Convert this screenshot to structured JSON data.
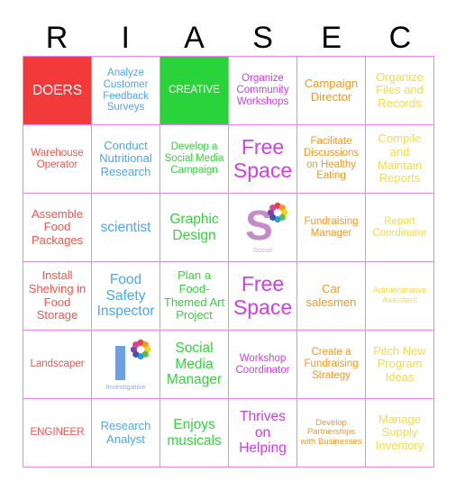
{
  "card": {
    "title": "RIASEC Bingo Card",
    "columns": 6,
    "rows": 6,
    "border_color": "#ee82ee"
  },
  "header": {
    "letters": [
      "R",
      "I",
      "A",
      "S",
      "E",
      "C"
    ],
    "color": "#000000"
  },
  "palette": {
    "realistic_text": "#f4564f",
    "investigative_text": "#4aa8ef",
    "artistic_text": "#35d43c",
    "social_text": "#d43ce8",
    "enterprising_text": "#f59a20",
    "conventional_text": "#fadc3c",
    "filled_red": "#f33a3a",
    "filled_green": "#2ad33a",
    "filled_text": "#ffffff",
    "grid_border": "#ee82ee"
  },
  "cells": [
    {
      "text": "DOERS",
      "column": "R",
      "size": "fs-l",
      "state": "filled-red"
    },
    {
      "text": "Analyze Customer Feedback Surveys",
      "column": "I",
      "size": "fs-s",
      "state": "empty"
    },
    {
      "text": "CREATIVE",
      "column": "A",
      "size": "fs-s",
      "state": "filled-green"
    },
    {
      "text": "Organize Community Workshops",
      "column": "S",
      "size": "fs-s",
      "state": "empty"
    },
    {
      "text": "Campaign Director",
      "column": "E",
      "size": "fs-m",
      "state": "empty"
    },
    {
      "text": "Organize Files and Records",
      "column": "C",
      "size": "fs-m",
      "state": "empty"
    },
    {
      "text": "Warehouse Operator",
      "column": "R",
      "size": "fs-s",
      "state": "empty"
    },
    {
      "text": "Conduct Nutritional Research",
      "column": "I",
      "size": "fs-m",
      "state": "empty"
    },
    {
      "text": "Develop a Social Media Campaign",
      "column": "A",
      "size": "fs-s",
      "state": "empty"
    },
    {
      "text": "Free Space",
      "column": "S",
      "size": "fs-xl",
      "state": "empty"
    },
    {
      "text": "Facilitate Discussions on Healthy Eating",
      "column": "E",
      "size": "fs-s",
      "state": "empty"
    },
    {
      "text": "Compile and Maintain Reports",
      "column": "C",
      "size": "fs-m",
      "state": "empty"
    },
    {
      "text": "Assemble Food Packages",
      "column": "R",
      "size": "fs-m",
      "state": "empty"
    },
    {
      "text": "scientist",
      "column": "I",
      "size": "fs-l",
      "state": "empty"
    },
    {
      "text": "Graphic Design",
      "column": "A",
      "size": "fs-l",
      "state": "empty"
    },
    {
      "text": "",
      "column": "S",
      "size": "fs-m",
      "state": "icon",
      "icon": "social-logo-icon",
      "caption": "Social"
    },
    {
      "text": "Fundraising Manager",
      "column": "E",
      "size": "fs-s",
      "state": "empty"
    },
    {
      "text": "Report Coordinator",
      "column": "C",
      "size": "fs-s",
      "state": "empty"
    },
    {
      "text": "Install Shelving in Food Storage",
      "column": "R",
      "size": "fs-m",
      "state": "empty"
    },
    {
      "text": "Food Safety Inspector",
      "column": "I",
      "size": "fs-l",
      "state": "empty"
    },
    {
      "text": "Plan a Food-Themed Art Project",
      "column": "A",
      "size": "fs-m",
      "state": "empty"
    },
    {
      "text": "Free Space",
      "column": "S",
      "size": "fs-xl",
      "state": "empty"
    },
    {
      "text": "Car salesmen",
      "column": "E",
      "size": "fs-m",
      "state": "empty"
    },
    {
      "text": "Administrative Assistant",
      "column": "C",
      "size": "fs-xs",
      "state": "empty"
    },
    {
      "text": "Landscaper",
      "column": "R",
      "size": "fs-s",
      "state": "empty"
    },
    {
      "text": "",
      "column": "I",
      "size": "fs-m",
      "state": "icon",
      "icon": "investigative-logo-icon",
      "caption": "Investigative"
    },
    {
      "text": "Social Media Manager",
      "column": "A",
      "size": "fs-l",
      "state": "empty"
    },
    {
      "text": "Workshop Coordinator",
      "column": "S",
      "size": "fs-s",
      "state": "empty"
    },
    {
      "text": "Create a Fundraising Strategy",
      "column": "E",
      "size": "fs-s",
      "state": "empty"
    },
    {
      "text": "Pitch New Program Ideas",
      "column": "C",
      "size": "fs-m",
      "state": "empty"
    },
    {
      "text": "ENGINEER",
      "column": "R",
      "size": "fs-s",
      "state": "empty"
    },
    {
      "text": "Research Analyst",
      "column": "I",
      "size": "fs-m",
      "state": "empty"
    },
    {
      "text": "Enjoys musicals",
      "column": "A",
      "size": "fs-l",
      "state": "empty"
    },
    {
      "text": "Thrives on Helping",
      "column": "S",
      "size": "fs-l",
      "state": "empty"
    },
    {
      "text": "Develop Partnerships with Businesses",
      "column": "E",
      "size": "fs-xs",
      "state": "empty"
    },
    {
      "text": "Manage Supply Inventory",
      "column": "C",
      "size": "fs-m",
      "state": "empty"
    }
  ]
}
